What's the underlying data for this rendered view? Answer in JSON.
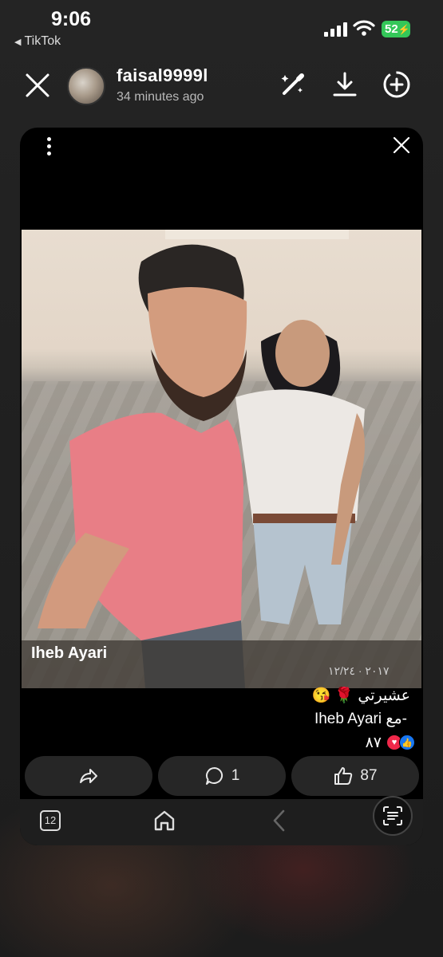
{
  "status_bar": {
    "time": "9:06",
    "back_app": "TikTok",
    "battery": "52"
  },
  "header": {
    "username": "faisal9999l",
    "posted": "34 minutes ago"
  },
  "post": {
    "photo_name": "Iheb Ayari",
    "photo_meta": "٢٠١٧ · ١٢/٢٤",
    "caption_line1": "عشيرتي 🌹 😘",
    "caption_line2": "Iheb Ayari مع-",
    "reaction_count": "٨٧"
  },
  "actions": {
    "comment_count": "1",
    "like_count": "87"
  },
  "bottom_nav": {
    "tab_count": "12"
  },
  "colors": {
    "battery": "#34c759",
    "like_blue": "#1877f2",
    "love_red": "#f0284a"
  }
}
